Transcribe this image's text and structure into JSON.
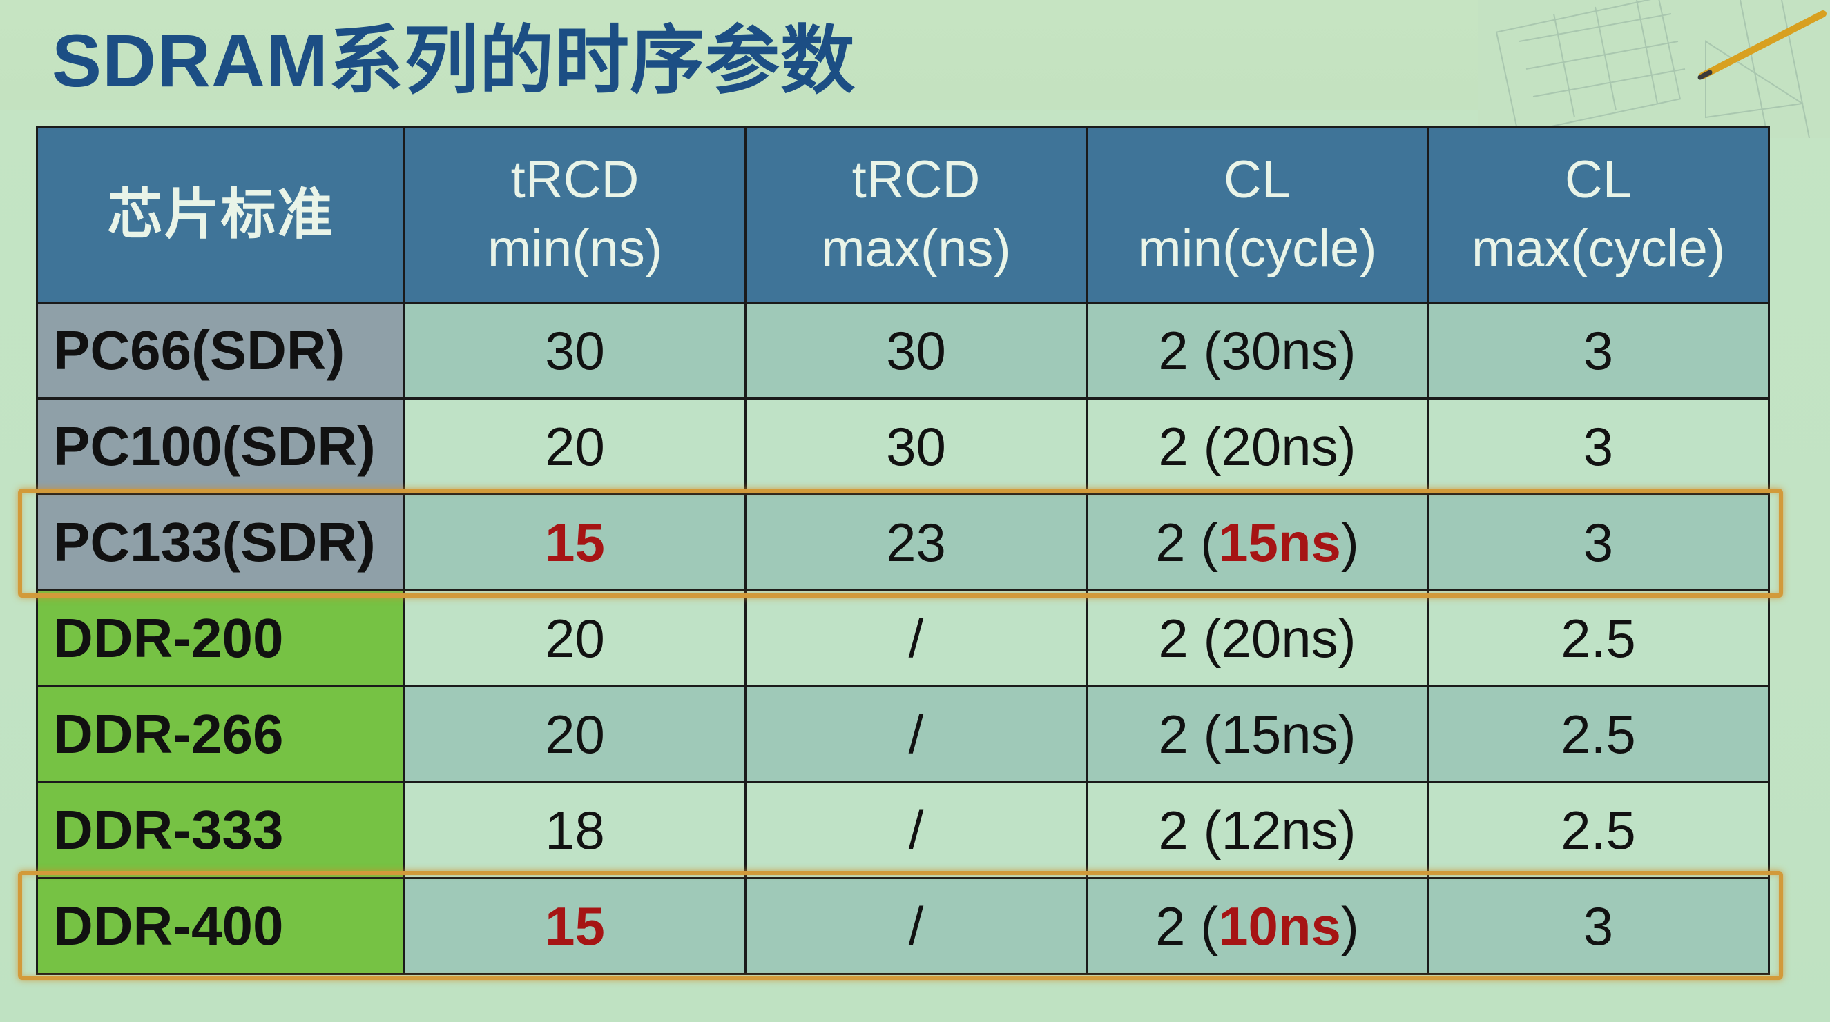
{
  "slide": {
    "title": "SDRAM系列的时序参数",
    "colors": {
      "title": "#1c4e84",
      "header_bg": "#3f7498",
      "highlight_text": "#a61414",
      "highlight_box": "#d29a3a",
      "sdr_label_bg": "#8fa0a8",
      "ddr_label_bg": "#76c244"
    },
    "decoration_icon": "pencil-and-ruler-icon"
  },
  "table": {
    "headers": [
      {
        "line1": "芯片标准",
        "line2": ""
      },
      {
        "line1": "tRCD",
        "line2": "min(ns)"
      },
      {
        "line1": "tRCD",
        "line2": "max(ns)"
      },
      {
        "line1": "CL",
        "line2": "min(cycle)"
      },
      {
        "line1": "CL",
        "line2": "max(cycle)"
      }
    ],
    "rows": [
      {
        "chip": "PC66(SDR)",
        "trcd_min": "30",
        "trcd_max": "30",
        "cl_min_value": "2",
        "cl_min_ns": "30ns",
        "cl_max": "3"
      },
      {
        "chip": "PC100(SDR)",
        "trcd_min": "20",
        "trcd_max": "30",
        "cl_min_value": "2",
        "cl_min_ns": "20ns",
        "cl_max": "3"
      },
      {
        "chip": "PC133(SDR)",
        "trcd_min": "15",
        "trcd_max": "23",
        "cl_min_value": "2",
        "cl_min_ns": "15ns",
        "cl_max": "3"
      },
      {
        "chip": "DDR-200",
        "trcd_min": "20",
        "trcd_max": "/",
        "cl_min_value": "2",
        "cl_min_ns": "20ns",
        "cl_max": "2.5"
      },
      {
        "chip": "DDR-266",
        "trcd_min": "20",
        "trcd_max": "/",
        "cl_min_value": "2",
        "cl_min_ns": "15ns",
        "cl_max": "2.5"
      },
      {
        "chip": "DDR-333",
        "trcd_min": "18",
        "trcd_max": "/",
        "cl_min_value": "2",
        "cl_min_ns": "12ns",
        "cl_max": "2.5"
      },
      {
        "chip": "DDR-400",
        "trcd_min": "15",
        "trcd_max": "/",
        "cl_min_value": "2",
        "cl_min_ns": "10ns",
        "cl_max": "3"
      }
    ]
  }
}
